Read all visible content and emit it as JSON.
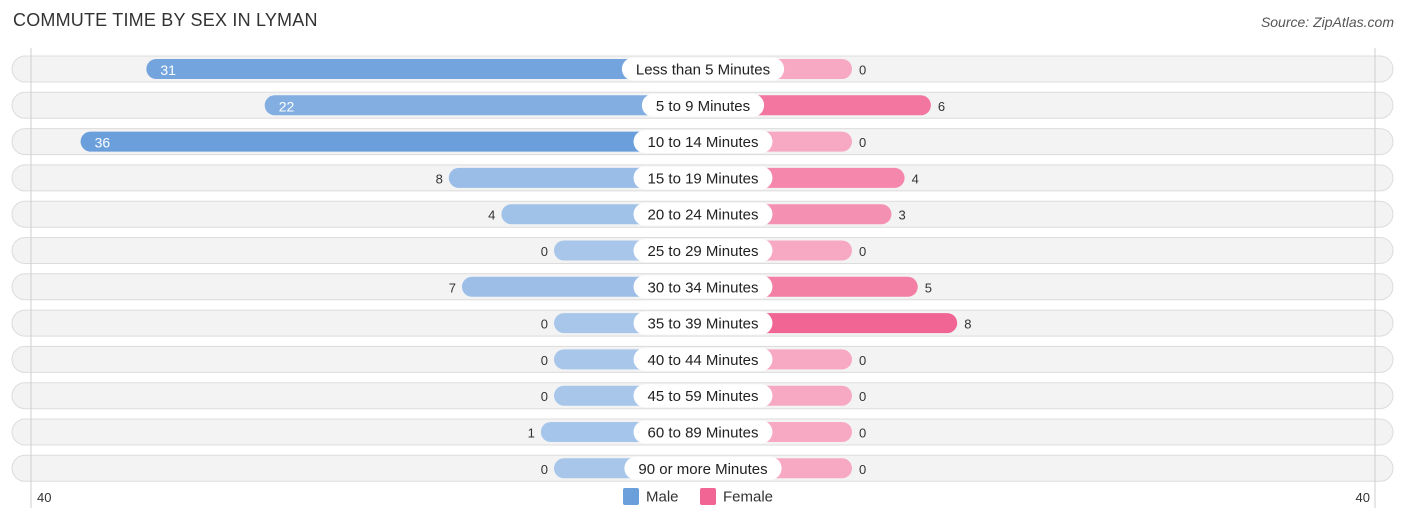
{
  "header": {
    "title": "COMMUTE TIME BY SEX IN LYMAN",
    "source": "Source: ZipAtlas.com"
  },
  "colors": {
    "male": "#6a9fdb",
    "male_light": "#a8c6ea",
    "female": "#f06593",
    "female_light": "#f7a9c3",
    "row_bg": "#f3f3f3"
  },
  "chart_data": {
    "type": "bar",
    "orientation": "horizontal-diverging",
    "title": "COMMUTE TIME BY SEX IN LYMAN",
    "categories": [
      "Less than 5 Minutes",
      "5 to 9 Minutes",
      "10 to 14 Minutes",
      "15 to 19 Minutes",
      "20 to 24 Minutes",
      "25 to 29 Minutes",
      "30 to 34 Minutes",
      "35 to 39 Minutes",
      "40 to 44 Minutes",
      "45 to 59 Minutes",
      "60 to 89 Minutes",
      "90 or more Minutes"
    ],
    "series": [
      {
        "name": "Male",
        "values": [
          31,
          22,
          36,
          8,
          4,
          0,
          7,
          0,
          0,
          0,
          1,
          0
        ]
      },
      {
        "name": "Female",
        "values": [
          0,
          6,
          0,
          4,
          3,
          0,
          5,
          8,
          0,
          0,
          0,
          0
        ]
      }
    ],
    "axis": {
      "left_label": "40",
      "right_label": "40",
      "max": 40
    },
    "legend": {
      "position": "bottom-center",
      "items": [
        "Male",
        "Female"
      ]
    }
  }
}
